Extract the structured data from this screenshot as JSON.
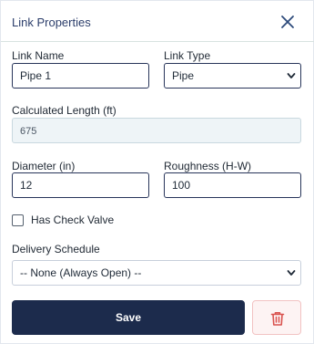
{
  "header": {
    "title": "Link Properties",
    "close_icon": "close-icon"
  },
  "form": {
    "link_name": {
      "label": "Link Name",
      "value": "Pipe 1"
    },
    "link_type": {
      "label": "Link Type",
      "selected": "Pipe"
    },
    "calculated_length": {
      "label": "Calculated Length (ft)",
      "value": "675"
    },
    "diameter": {
      "label": "Diameter (in)",
      "value": "12"
    },
    "roughness": {
      "label": "Roughness (H-W)",
      "value": "100"
    },
    "check_valve": {
      "label": "Has Check Valve",
      "checked": false
    },
    "delivery_schedule": {
      "label": "Delivery Schedule",
      "selected": "-- None (Always Open) --"
    }
  },
  "actions": {
    "save_label": "Save",
    "delete_icon": "trash-icon"
  },
  "colors": {
    "accent": "#1c2b4c",
    "title": "#2c3e6b",
    "danger": "#d9534f",
    "readonly_bg": "#eef4f7"
  }
}
